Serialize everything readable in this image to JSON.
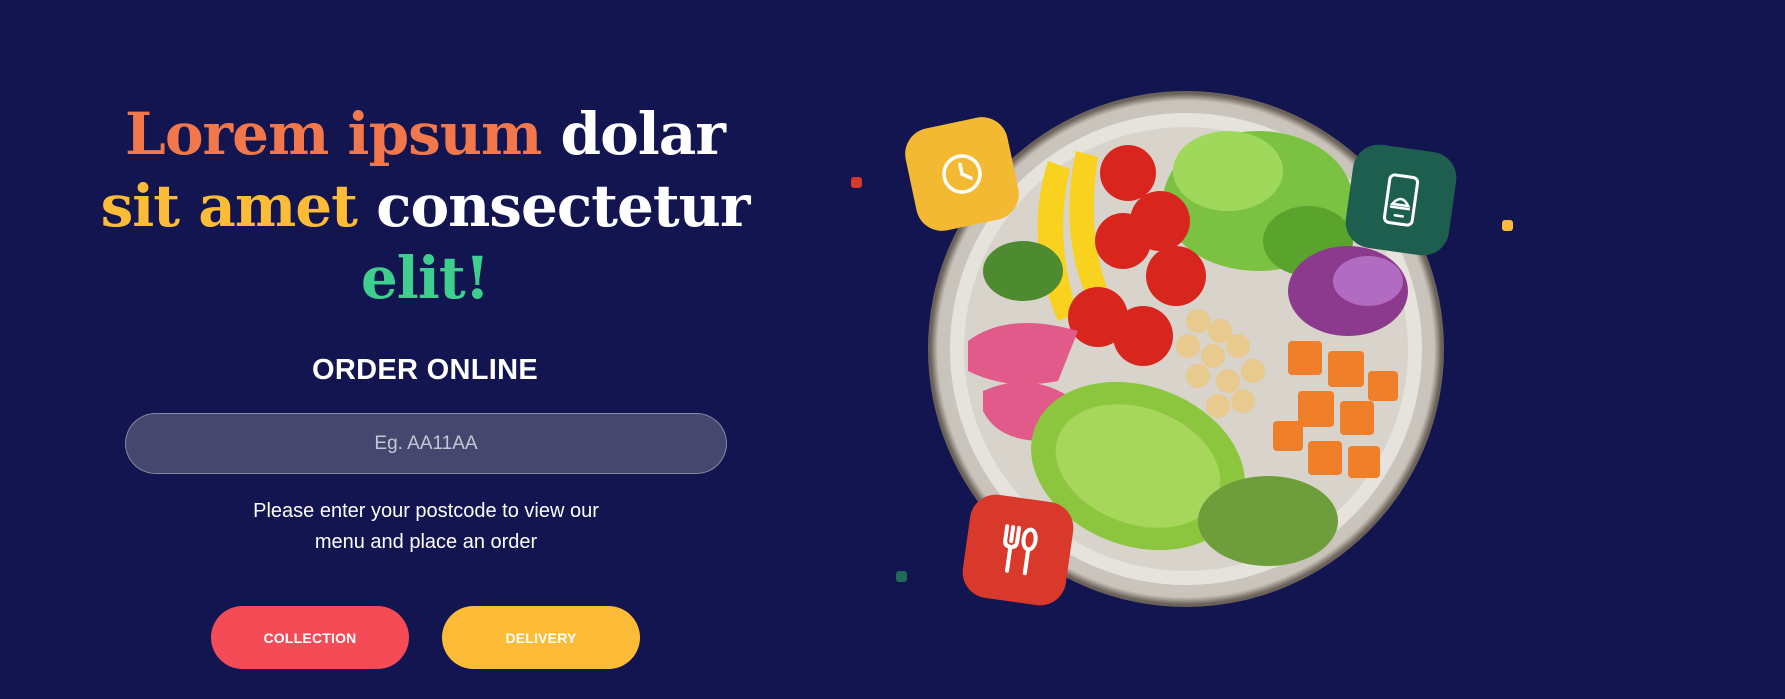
{
  "headline": {
    "line1_part1": "Lorem ipsum",
    "line1_part2": " dolar",
    "line2_part1": "sit amet",
    "line2_part2": " consectetur",
    "line3": "elit!"
  },
  "order": {
    "title": "ORDER ONLINE",
    "postcode_placeholder": "Eg. AA11AA",
    "postcode_value": "",
    "help_line1": "Please enter your postcode to view our",
    "help_line2": "menu and place an order"
  },
  "buttons": {
    "collection": "COLLECTION",
    "delivery": "DELIVERY"
  },
  "hero": {
    "image": "salad-bowl",
    "badges": [
      {
        "icon": "clock-icon",
        "color": "#f4b932"
      },
      {
        "icon": "mobile-order-icon",
        "color": "#1e5e4f"
      },
      {
        "icon": "fork-spoon-icon",
        "color": "#d9392b"
      }
    ]
  },
  "colors": {
    "background": "#12154f",
    "orange": "#f2784b",
    "yellow": "#fdbc37",
    "green": "#3ecf8e",
    "collection": "#f44b57",
    "delivery": "#fdbc37"
  }
}
